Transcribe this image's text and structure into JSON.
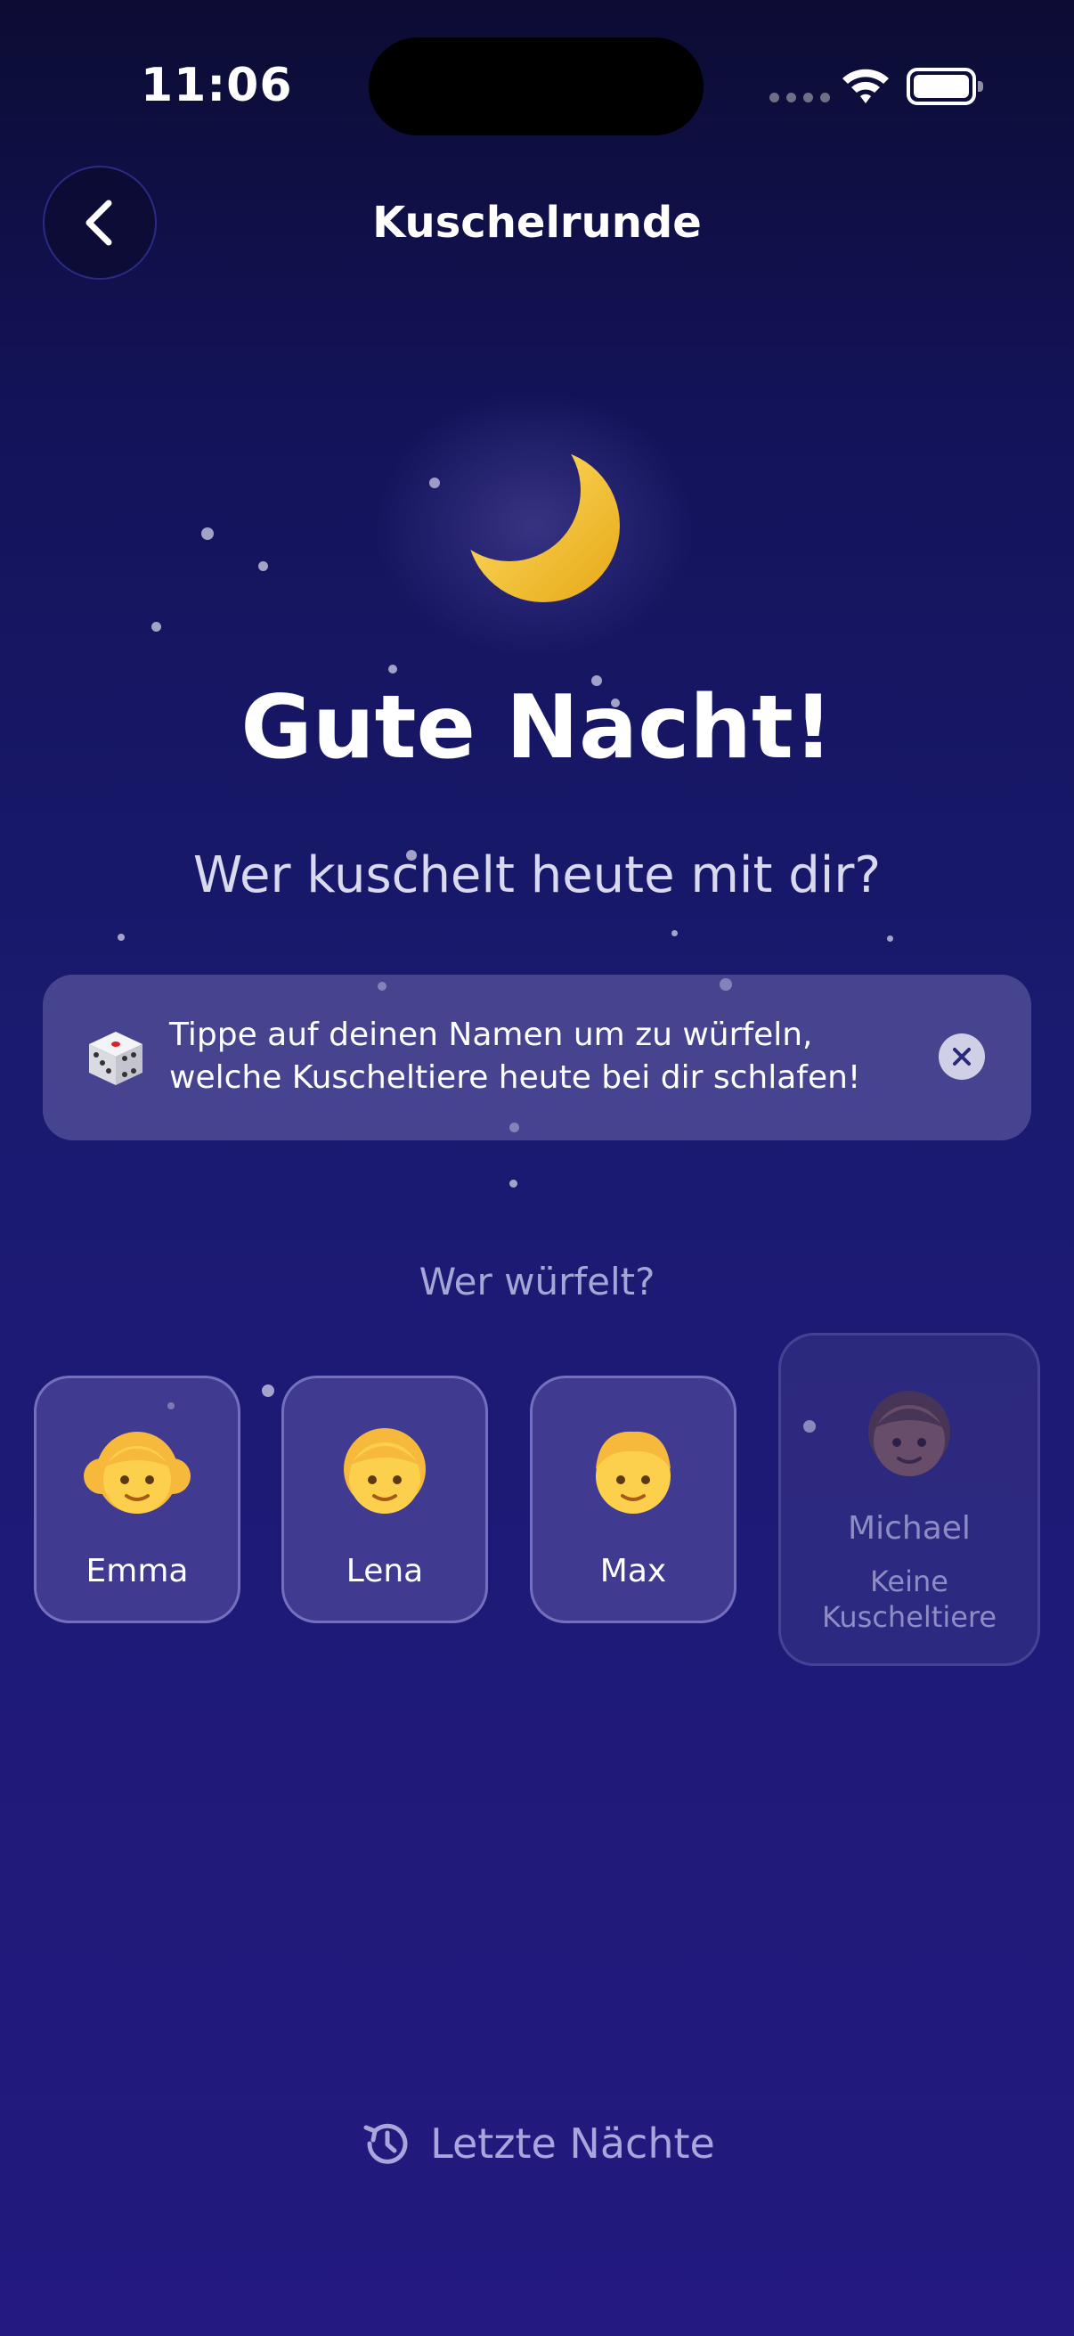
{
  "status_bar": {
    "time": "11:06"
  },
  "nav": {
    "title": "Kuschelrunde",
    "back_icon": "chevron-left-icon"
  },
  "hero": {
    "icon": "crescent-moon-icon",
    "title": "Gute Nacht!",
    "subtitle": "Wer kuschelt heute mit dir?"
  },
  "info": {
    "icon": "dice-icon",
    "line1": "Tippe auf deinen Namen um zu würfeln,",
    "line2": "welche Kuscheltiere heute bei dir schlafen!",
    "close_icon": "close-icon"
  },
  "section_label": "Wer würfelt?",
  "kids": [
    {
      "name": "Emma",
      "icon": "girl-icon",
      "enabled": true
    },
    {
      "name": "Lena",
      "icon": "child-icon",
      "enabled": true
    },
    {
      "name": "Max",
      "icon": "boy-icon",
      "enabled": true
    },
    {
      "name": "Michael",
      "icon": "child-dark-icon",
      "enabled": false,
      "note_line1": "Keine",
      "note_line2": "Kuscheltiere"
    }
  ],
  "history": {
    "icon": "history-icon",
    "label": "Letzte Nächte"
  },
  "colors": {
    "accent": "#a8a6dc",
    "moon": "#f7c52b",
    "background_top": "#0c0c34",
    "background_bottom": "#23197e"
  }
}
